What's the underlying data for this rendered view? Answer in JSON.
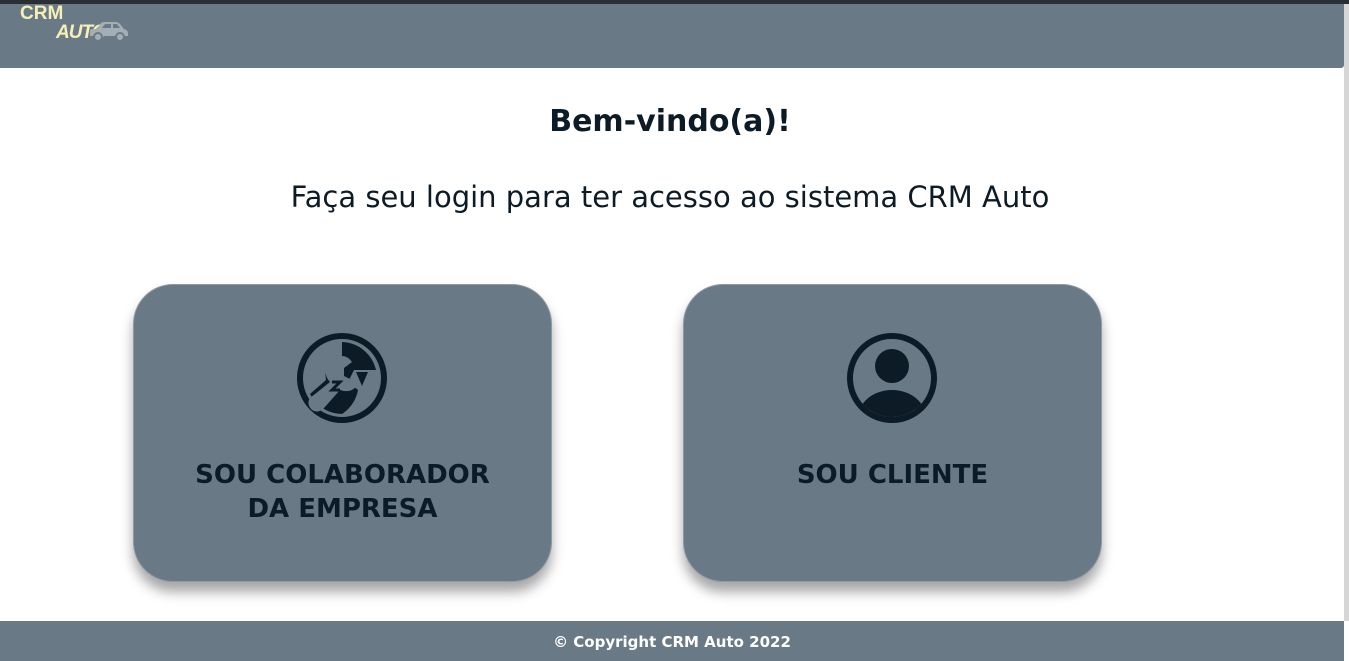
{
  "header": {
    "logo_line1": "CRM",
    "logo_line2": "AUTO",
    "logo_icon": "car-icon",
    "logo_color": "#f6efb6",
    "background": "#697985"
  },
  "main": {
    "welcome": "Bem-vindo(a)!",
    "subtitle": "Faça seu login para ter acesso ao sistema CRM Auto"
  },
  "cards": [
    {
      "label_line1": "SOU COLABORADOR",
      "label_line2": "DA EMPRESA",
      "icon": "wrench-icon"
    },
    {
      "label_line1": "SOU CLIENTE",
      "icon": "user-circle-icon"
    }
  ],
  "footer": {
    "text": "© Copyright CRM Auto 2022"
  },
  "colors": {
    "card_bg": "#697985",
    "text_dark": "#0d1b26"
  }
}
